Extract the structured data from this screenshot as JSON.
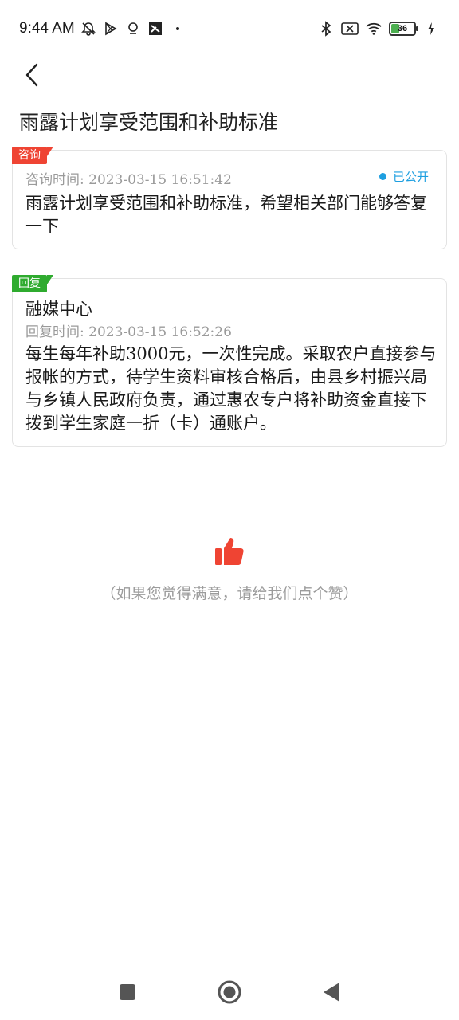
{
  "status_bar": {
    "time": "9:44 AM",
    "battery_level": "36",
    "battery_fraction": 0.36,
    "icons_left": [
      "notification-muted-icon",
      "play-store-icon",
      "location-icon",
      "app-icon",
      "dot-icon"
    ],
    "icons_right": [
      "bluetooth-icon",
      "sim-disabled-icon",
      "wifi-icon",
      "battery-icon",
      "charging-icon"
    ]
  },
  "header": {
    "title": "雨露计划享受范围和补助标准"
  },
  "consult": {
    "tag": "咨询",
    "time_label": "咨询时间:",
    "time_value": "2023-03-15  16:51:42",
    "status": "已公开",
    "content": "雨露计划享受范围和补助标准，希望相关部门能够答复一下"
  },
  "reply": {
    "tag": "回复",
    "org": "融媒中心",
    "time_label": "回复时间:",
    "time_value": "2023-03-15  16:52:26",
    "content": "每生每年补助3000元，一次性完成。采取农户直接参与报帐的方式，待学生资料审核合格后，由县乡村振兴局与乡镇人民政府负责，通过惠农专户将补助资金直接下拨到学生家庭一折（卡）通账户。"
  },
  "like": {
    "hint": "（如果您觉得满意，请给我们点个赞）"
  },
  "colors": {
    "accent_red": "#ef4433",
    "accent_green": "#2fab2f",
    "status_blue": "#1e9fe0",
    "meta_gray": "#9a9a9a"
  }
}
